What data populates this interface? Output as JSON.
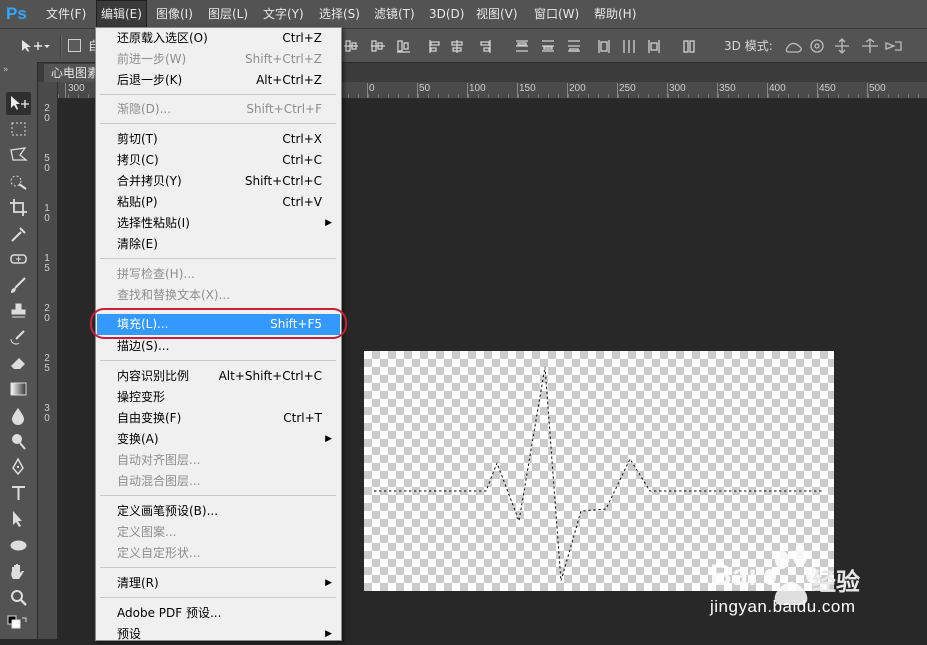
{
  "app": {
    "logo": "Ps"
  },
  "menubar": {
    "items": [
      {
        "label": "文件(F)"
      },
      {
        "label": "编辑(E)"
      },
      {
        "label": "图像(I)"
      },
      {
        "label": "图层(L)"
      },
      {
        "label": "文字(Y)"
      },
      {
        "label": "选择(S)"
      },
      {
        "label": "滤镜(T)"
      },
      {
        "label": "3D(D)"
      },
      {
        "label": "视图(V)"
      },
      {
        "label": "窗口(W)"
      },
      {
        "label": "帮助(H)"
      }
    ]
  },
  "optionsbar": {
    "mode_label": "3D 模式:",
    "auto_label": "自"
  },
  "document": {
    "tab_title": "心电图素"
  },
  "ruler": {
    "h_labels": [
      "300",
      "0",
      "50",
      "100",
      "150",
      "200",
      "250",
      "300",
      "350",
      "400",
      "450",
      "500"
    ],
    "v_labels": [
      "2",
      "0",
      "5",
      "0",
      "1",
      "0",
      "1",
      "5",
      "2",
      "0",
      "2",
      "5",
      "3",
      "0"
    ]
  },
  "edit_menu": {
    "items": [
      {
        "label": "还原载入选区(O)",
        "shortcut": "Ctrl+Z"
      },
      {
        "label": "前进一步(W)",
        "shortcut": "Shift+Ctrl+Z"
      },
      {
        "label": "后退一步(K)",
        "shortcut": "Alt+Ctrl+Z"
      },
      {
        "label": "渐隐(D)...",
        "shortcut": "Shift+Ctrl+F"
      },
      {
        "label": "剪切(T)",
        "shortcut": "Ctrl+X"
      },
      {
        "label": "拷贝(C)",
        "shortcut": "Ctrl+C"
      },
      {
        "label": "合并拷贝(Y)",
        "shortcut": "Shift+Ctrl+C"
      },
      {
        "label": "粘贴(P)",
        "shortcut": "Ctrl+V"
      },
      {
        "label": "选择性粘贴(I)",
        "shortcut": ""
      },
      {
        "label": "清除(E)",
        "shortcut": ""
      },
      {
        "label": "拼写检查(H)...",
        "shortcut": ""
      },
      {
        "label": "查找和替换文本(X)...",
        "shortcut": ""
      },
      {
        "label": "填充(L)...",
        "shortcut": "Shift+F5"
      },
      {
        "label": "描边(S)...",
        "shortcut": ""
      },
      {
        "label": "内容识别比例",
        "shortcut": "Alt+Shift+Ctrl+C"
      },
      {
        "label": "操控变形",
        "shortcut": ""
      },
      {
        "label": "自由变换(F)",
        "shortcut": "Ctrl+T"
      },
      {
        "label": "变换(A)",
        "shortcut": ""
      },
      {
        "label": "自动对齐图层...",
        "shortcut": ""
      },
      {
        "label": "自动混合图层...",
        "shortcut": ""
      },
      {
        "label": "定义画笔预设(B)...",
        "shortcut": ""
      },
      {
        "label": "定义图案...",
        "shortcut": ""
      },
      {
        "label": "定义自定形状...",
        "shortcut": ""
      },
      {
        "label": "清理(R)",
        "shortcut": ""
      },
      {
        "label": "Adobe PDF 预设...",
        "shortcut": ""
      },
      {
        "label": "预设",
        "shortcut": ""
      }
    ]
  },
  "watermark": {
    "cn": "经验",
    "url": "jingyan.baidu.com"
  },
  "colors": {
    "accent": "#3399ff",
    "highlight_ring": "#c8203a",
    "ps_blue": "#31a8ff"
  }
}
